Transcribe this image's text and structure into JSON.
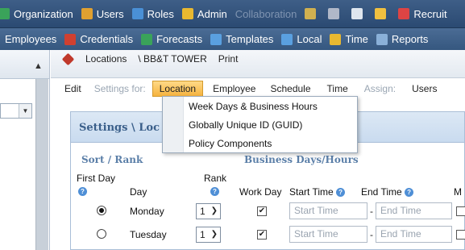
{
  "top_nav": [
    {
      "label": "Organization",
      "icon": "organization-icon",
      "color": "#3aa35a"
    },
    {
      "label": "Users",
      "icon": "users-icon",
      "color": "#e0a030"
    },
    {
      "label": "Roles",
      "icon": "roles-icon",
      "color": "#4a90d6"
    },
    {
      "label": "Admin",
      "icon": "admin-icon",
      "color": "#e8b830"
    },
    {
      "label": "Collaboration",
      "icon": "",
      "color": ""
    },
    {
      "label": "",
      "icon": "calendar-icon",
      "color": "#d0b050"
    },
    {
      "label": "",
      "icon": "tools-icon",
      "color": "#b0b8c8"
    },
    {
      "label": "",
      "icon": "window-icon",
      "color": "#dfe6ee"
    },
    {
      "label": "",
      "icon": "notes-icon",
      "color": "#f0c040"
    },
    {
      "label": "Recruit",
      "icon": "recruit-icon",
      "color": "#d44"
    }
  ],
  "second_nav": [
    {
      "label": "Employees",
      "icon": "",
      "color": ""
    },
    {
      "label": "Credentials",
      "icon": "credentials-icon",
      "color": "#d04030"
    },
    {
      "label": "Forecasts",
      "icon": "forecasts-icon",
      "color": "#3aa35a"
    },
    {
      "label": "Templates",
      "icon": "templates-icon",
      "color": "#5aa0e0"
    },
    {
      "label": "Local",
      "icon": "local-icon",
      "color": "#5aa0e0"
    },
    {
      "label": "Time",
      "icon": "time-icon",
      "color": "#e8b830"
    },
    {
      "label": "Reports",
      "icon": "reports-icon",
      "color": "#8ab0d8"
    }
  ],
  "toolbar": {
    "locations": "Locations",
    "breadcrumb": "\\ BB&T TOWER",
    "print": "Print"
  },
  "menubar": {
    "edit": "Edit",
    "settings_for": "Settings for:",
    "location": "Location",
    "employee": "Employee",
    "schedule": "Schedule",
    "time": "Time",
    "assign": "Assign:",
    "users": "Users"
  },
  "dropdown": [
    "Week Days & Business Hours",
    "Globally Unique ID (GUID)",
    "Policy Components"
  ],
  "panel": {
    "title": "Settings \\ Loc",
    "sort_rank": "Sort / Rank",
    "business_days": "Business Days/Hours",
    "first_day": "First Day",
    "day": "Day",
    "rank": "Rank",
    "work_day": "Work Day",
    "start_time": "Start Time",
    "end_time": "End Time",
    "trailing_col": "M"
  },
  "rows": [
    {
      "day": "Monday",
      "rank": "1",
      "first_day_selected": true,
      "work_day": true,
      "start_placeholder": "Start Time",
      "end_placeholder": "End Time"
    },
    {
      "day": "Tuesday",
      "rank": "1",
      "first_day_selected": false,
      "work_day": true,
      "start_placeholder": "Start Time",
      "end_placeholder": "End Time"
    }
  ]
}
